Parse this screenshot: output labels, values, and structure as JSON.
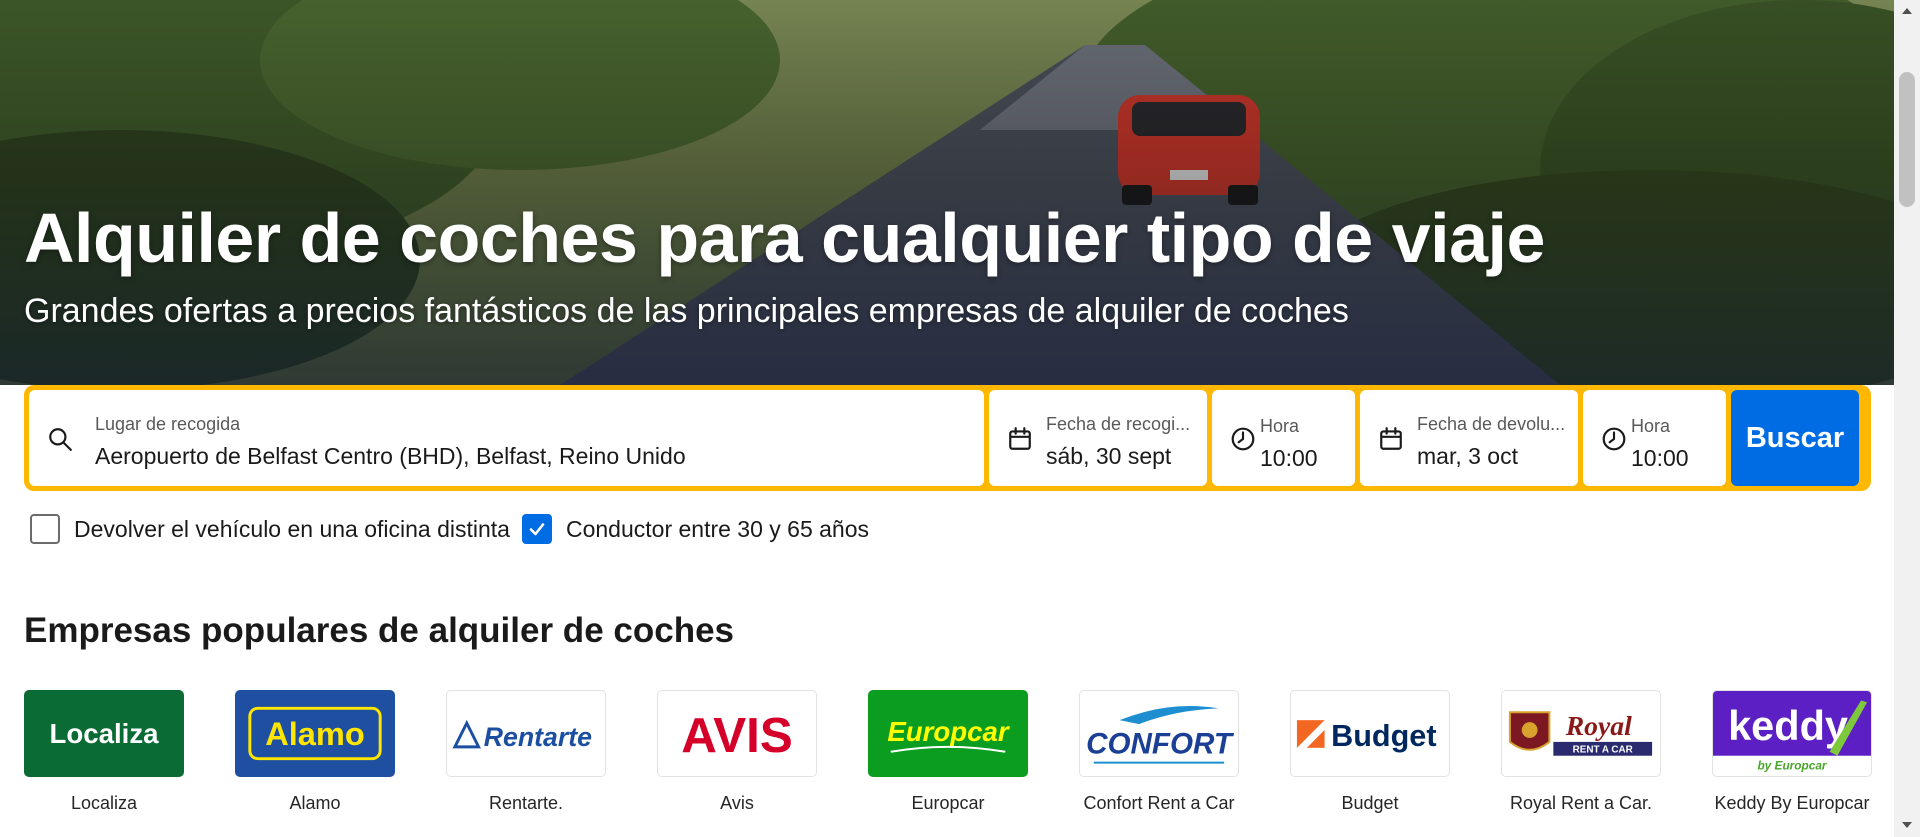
{
  "hero": {
    "title": "Alquiler de coches para cualquier tipo de viaje",
    "subtitle": "Grandes ofertas a precios fantásticos de las principales empresas de alquiler de coches"
  },
  "search": {
    "pickup_label": "Lugar de recogida",
    "pickup_value": "Aeropuerto de Belfast Centro (BHD), Belfast, Reino Unido",
    "pickup_date_label": "Fecha de recogi...",
    "pickup_date_value": "sáb, 30 sept",
    "pickup_time_label": "Hora",
    "pickup_time_value": "10:00",
    "return_date_label": "Fecha de devolu...",
    "return_date_value": "mar, 3 oct",
    "return_time_label": "Hora",
    "return_time_value": "10:00",
    "button_label": "Buscar"
  },
  "options": {
    "different_return": {
      "label": "Devolver el vehículo en una oficina distinta",
      "checked": false
    },
    "driver_age": {
      "label": "Conductor entre 30 y 65 años",
      "checked": true
    }
  },
  "companies_section": {
    "title": "Empresas populares de alquiler de coches",
    "items": [
      {
        "name": "Localiza",
        "logo_text": "Localiza",
        "bg": "#0b6b34",
        "fg": "#ffffff"
      },
      {
        "name": "Alamo",
        "logo_text": "Alamo",
        "bg": "#1f4fa0",
        "fg": "#ffe600"
      },
      {
        "name": "Rentarte.",
        "logo_text": "Rentarte",
        "bg": "#ffffff",
        "fg": "#1c4fa1"
      },
      {
        "name": "Avis",
        "logo_text": "AVIS",
        "bg": "#ffffff",
        "fg": "#d4002a"
      },
      {
        "name": "Europcar",
        "logo_text": "Europcar",
        "bg": "#0a9d1f",
        "fg": "#ffff00"
      },
      {
        "name": "Confort Rent a Car",
        "logo_text": "CONFORT",
        "bg": "#ffffff",
        "fg": "#1a3f95"
      },
      {
        "name": "Budget",
        "logo_text": "Budget",
        "bg": "#ffffff",
        "fg": "#00285f"
      },
      {
        "name": "Royal Rent a Car.",
        "logo_text": "Royal",
        "logo_subtext": "RENT A CAR",
        "bg": "#ffffff",
        "fg": "#8a1a1a"
      },
      {
        "name": "Keddy By Europcar",
        "logo_text": "keddy",
        "logo_subtext": "by Europcar",
        "bg": "#5b1fc4",
        "fg": "#ffffff"
      }
    ]
  },
  "colors": {
    "accent_blue": "#006ce4",
    "search_border": "#ffb700"
  },
  "icons": {
    "pickup": "search-icon",
    "date": "calendar-icon",
    "time": "clock-icon"
  }
}
